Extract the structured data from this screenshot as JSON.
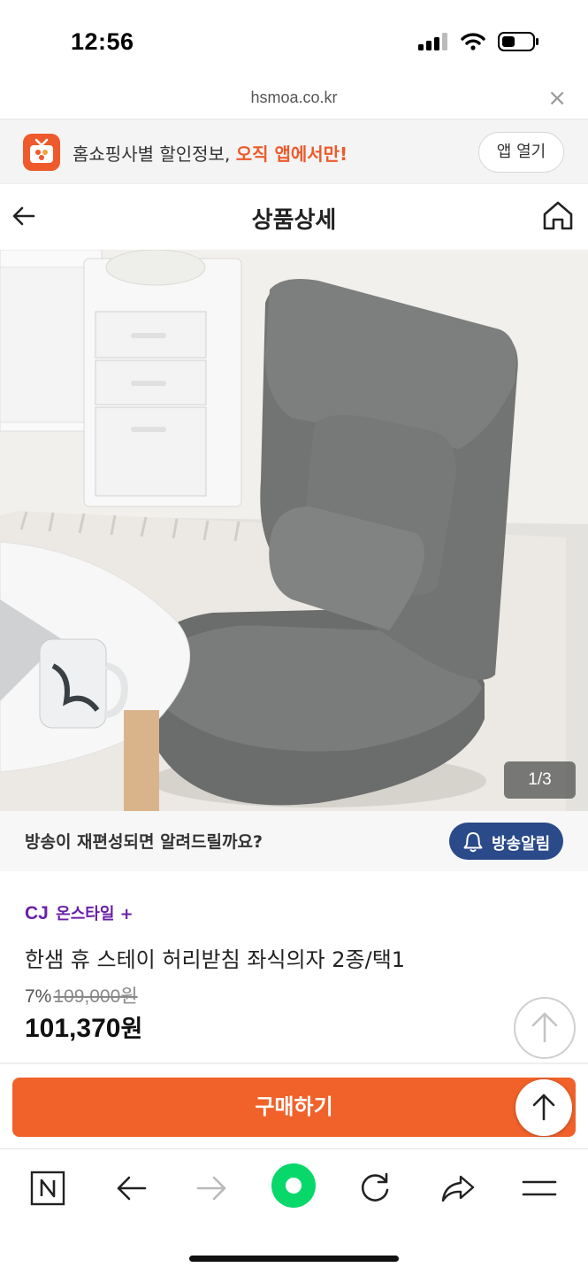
{
  "status": {
    "time": "12:56"
  },
  "browser": {
    "url": "hsmoa.co.kr",
    "close": "×"
  },
  "app_banner": {
    "text": "홈쇼핑사별 할인정보, ",
    "highlight": "오직 앱에서만!",
    "button": "앱 열기",
    "accent": "#ee5a2b"
  },
  "header": {
    "title": "상품상세"
  },
  "gallery": {
    "counter": "1/3"
  },
  "notify": {
    "text": "방송이 재편성되면 알려드릴까요?",
    "button": "방송알림",
    "button_color": "#2a4a8a"
  },
  "product": {
    "brand_mark": "CJ",
    "brand_name": "온스타일",
    "brand_plus": "+",
    "name": "한샘 휴 스테이 허리받침 좌식의자 2종/택1",
    "discount": "7%",
    "original_price": "109,000원",
    "sale_price": "101,370",
    "sale_unit": "원"
  },
  "actions": {
    "buy": "구매하기",
    "buy_color": "#f0622a"
  },
  "icons": {
    "back": "arrow-left-icon",
    "home": "home-icon",
    "bell": "bell-icon",
    "scroll_top": "arrow-up-icon",
    "toolbar": [
      "naver-n-icon",
      "back-arrow-icon",
      "forward-arrow-icon",
      "green-dot-icon",
      "reload-icon",
      "share-icon",
      "menu-icon"
    ]
  }
}
